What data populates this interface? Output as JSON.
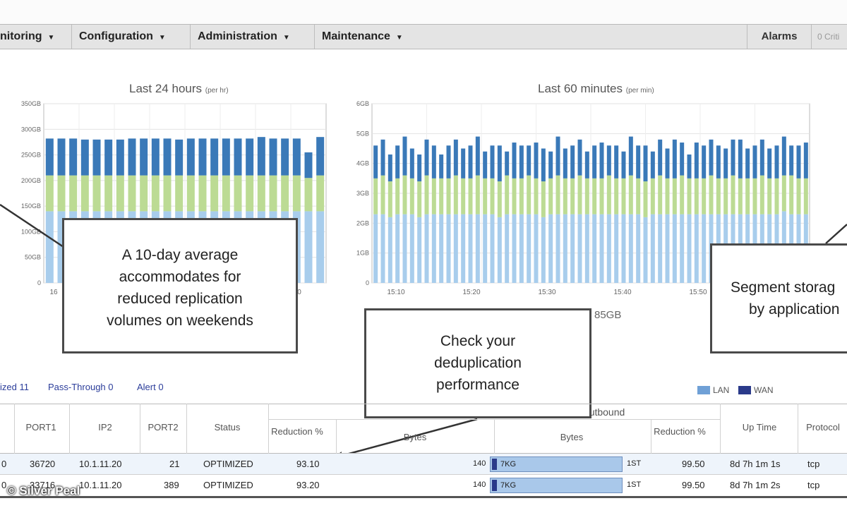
{
  "menu": {
    "items": [
      {
        "label": "nitoring"
      },
      {
        "label": "Configuration"
      },
      {
        "label": "Administration"
      },
      {
        "label": "Maintenance"
      }
    ],
    "alarms_label": "Alarms",
    "critical_label": "0 Criti"
  },
  "chart_data": [
    {
      "type": "bar",
      "title": "Last 24 hours",
      "title_unit": "(per hr)",
      "y_ticks": [
        "0",
        "50GB",
        "100GB",
        "150GB",
        "200GB",
        "250GB",
        "300GB",
        "350GB"
      ],
      "ylim": [
        0,
        350
      ],
      "visible_x_tick": "16",
      "x_tick_right": "0",
      "series": [
        {
          "color": "#a8cdec",
          "values": [
            140,
            140,
            140,
            140,
            140,
            140,
            140,
            140,
            140,
            140,
            140,
            140,
            140,
            140,
            140,
            140,
            140,
            140,
            140,
            140,
            140,
            140,
            140,
            140
          ]
        },
        {
          "color": "#bcdb94",
          "values": [
            70,
            70,
            70,
            70,
            70,
            70,
            70,
            70,
            70,
            70,
            70,
            70,
            70,
            70,
            70,
            70,
            70,
            70,
            70,
            70,
            70,
            70,
            65,
            70
          ]
        },
        {
          "color": "#3a79b8",
          "values": [
            72,
            72,
            72,
            70,
            70,
            70,
            70,
            72,
            72,
            72,
            72,
            70,
            72,
            72,
            72,
            72,
            72,
            72,
            75,
            72,
            72,
            72,
            50,
            75
          ]
        }
      ]
    },
    {
      "type": "bar",
      "title": "Last 60 minutes",
      "title_unit": "(per min)",
      "y_ticks": [
        "0",
        "1GB",
        "2GB",
        "3GB",
        "4GB",
        "5GB",
        "6GB"
      ],
      "ylim": [
        0,
        6
      ],
      "x_ticks": [
        "15:10",
        "15:20",
        "15:30",
        "15:40",
        "15:50"
      ],
      "series": [
        {
          "color": "#a8cdec",
          "values": [
            2.3,
            2.3,
            2.2,
            2.3,
            2.3,
            2.3,
            2.2,
            2.3,
            2.3,
            2.3,
            2.3,
            2.3,
            2.3,
            2.3,
            2.3,
            2.3,
            2.3,
            2.2,
            2.3,
            2.3,
            2.3,
            2.3,
            2.3,
            2.2,
            2.3,
            2.3,
            2.3,
            2.3,
            2.3,
            2.3,
            2.3,
            2.3,
            2.3,
            2.3,
            2.3,
            2.3,
            2.3,
            2.2,
            2.3,
            2.3,
            2.3,
            2.3,
            2.3,
            2.3,
            2.3,
            2.3,
            2.3,
            2.3,
            2.3,
            2.3,
            2.3,
            2.3,
            2.3,
            2.3,
            2.3,
            2.3,
            2.4,
            2.3,
            2.3,
            2.3
          ]
        },
        {
          "color": "#bcdb94",
          "values": [
            1.2,
            1.3,
            1.2,
            1.2,
            1.3,
            1.2,
            1.2,
            1.3,
            1.2,
            1.2,
            1.2,
            1.3,
            1.2,
            1.2,
            1.3,
            1.2,
            1.2,
            1.2,
            1.3,
            1.2,
            1.2,
            1.3,
            1.2,
            1.2,
            1.2,
            1.3,
            1.2,
            1.2,
            1.3,
            1.2,
            1.2,
            1.2,
            1.3,
            1.2,
            1.2,
            1.3,
            1.2,
            1.2,
            1.2,
            1.3,
            1.2,
            1.2,
            1.3,
            1.2,
            1.2,
            1.2,
            1.3,
            1.2,
            1.2,
            1.3,
            1.2,
            1.2,
            1.2,
            1.3,
            1.2,
            1.2,
            1.2,
            1.3,
            1.2,
            1.2
          ]
        },
        {
          "color": "#3a79b8",
          "values": [
            1.1,
            1.2,
            0.9,
            1.1,
            1.3,
            1.0,
            0.9,
            1.2,
            1.1,
            0.8,
            1.1,
            1.2,
            1.0,
            1.1,
            1.3,
            0.9,
            1.1,
            1.2,
            0.8,
            1.2,
            1.1,
            1.0,
            1.2,
            1.1,
            0.9,
            1.3,
            1.0,
            1.1,
            1.2,
            0.9,
            1.1,
            1.2,
            1.0,
            1.1,
            0.9,
            1.3,
            1.1,
            1.2,
            0.9,
            1.2,
            1.0,
            1.3,
            1.1,
            0.8,
            1.2,
            1.1,
            1.2,
            1.1,
            1.0,
            1.2,
            1.3,
            1.0,
            1.1,
            1.2,
            1.0,
            1.1,
            1.3,
            1.0,
            1.1,
            1.2
          ]
        }
      ]
    }
  ],
  "chart2_caption": "85GB",
  "callouts": {
    "left": [
      "A 10-day average",
      "accommodates for",
      "reduced replication",
      "volumes on weekends"
    ],
    "middle": [
      "Check your",
      "deduplication",
      "performance"
    ],
    "right": [
      "Segment storag",
      "by application"
    ]
  },
  "status_counts": {
    "optimized": "ized 11",
    "pass_through": "Pass-Through 0",
    "alert": "Alert 0"
  },
  "legend": {
    "lan": "LAN",
    "wan": "WAN",
    "lan_color": "#6fa0d6",
    "wan_color": "#2a3a8a"
  },
  "table": {
    "group_header": "utbound",
    "headers": {
      "port1": "PORT1",
      "ip2": "IP2",
      "port2": "PORT2",
      "status": "Status",
      "reduction_in": "Reduction %",
      "bytes_in": "Bytes",
      "bytes_out": "Bytes",
      "reduction_out": "Reduction %",
      "uptime": "Up Time",
      "protocol": "Protocol"
    },
    "rows": [
      {
        "c0": "0",
        "port1": "36720",
        "ip2": "10.1.11.20",
        "port2": "21",
        "status": "OPTIMIZED",
        "reduction_in": "93.10",
        "bytes_in": "140",
        "bar_label": "7KG",
        "bar_right": "1ST",
        "reduction_out": "99.50",
        "uptime": "8d 7h 1m 1s",
        "protocol": "tcp",
        "progress": 0.94
      },
      {
        "c0": "0",
        "port1": "33716",
        "ip2": "10.1.11.20",
        "port2": "389",
        "status": "OPTIMIZED",
        "reduction_in": "93.20",
        "bytes_in": "140",
        "bar_label": "7KG",
        "bar_right": "1ST",
        "reduction_out": "99.50",
        "uptime": "8d 7h 1m 2s",
        "protocol": "tcp",
        "progress": 0.94
      }
    ]
  },
  "watermark": "© Silver Peal"
}
